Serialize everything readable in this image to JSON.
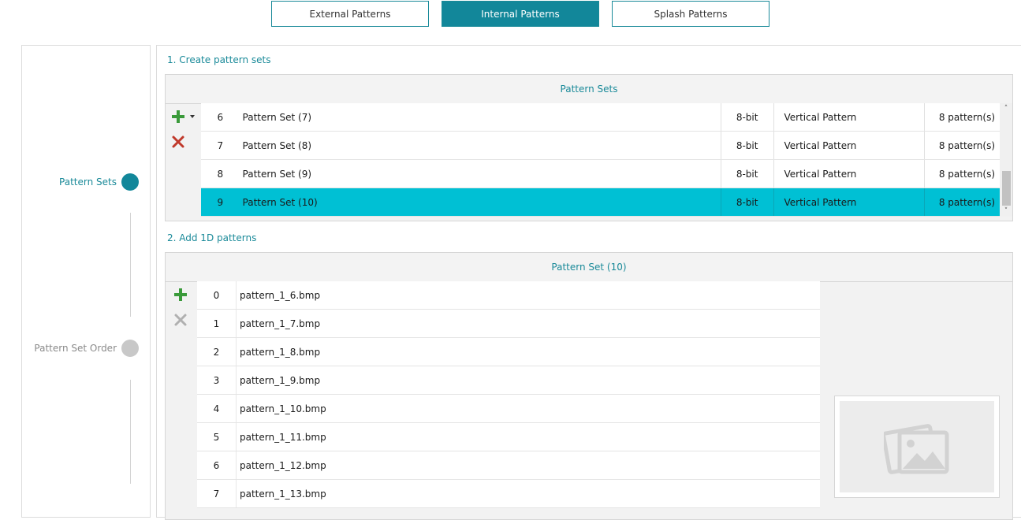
{
  "tabs": [
    {
      "label": "External Patterns",
      "active": false
    },
    {
      "label": "Internal Patterns",
      "active": true
    },
    {
      "label": "Splash Patterns",
      "active": false
    }
  ],
  "steps": [
    {
      "label": "Pattern Sets",
      "state": "active",
      "color": "#12879a"
    },
    {
      "label": "Pattern Set Order",
      "state": "inactive",
      "color": "#c8c8c8"
    }
  ],
  "section1": {
    "title": "1. Create pattern sets",
    "table_header": "Pattern Sets",
    "rows": [
      {
        "index": "6",
        "name": "Pattern Set (7)",
        "bits": "8-bit",
        "type": "Vertical Pattern",
        "count": "8 pattern(s)",
        "selected": false
      },
      {
        "index": "7",
        "name": "Pattern Set (8)",
        "bits": "8-bit",
        "type": "Vertical Pattern",
        "count": "8 pattern(s)",
        "selected": false
      },
      {
        "index": "8",
        "name": "Pattern Set (9)",
        "bits": "8-bit",
        "type": "Vertical Pattern",
        "count": "8 pattern(s)",
        "selected": false
      },
      {
        "index": "9",
        "name": "Pattern Set (10)",
        "bits": "8-bit",
        "type": "Vertical Pattern",
        "count": "8 pattern(s)",
        "selected": true
      }
    ]
  },
  "section2": {
    "title": "2. Add 1D patterns",
    "table_header": "Pattern Set (10)",
    "rows": [
      {
        "index": "0",
        "name": "pattern_1_6.bmp"
      },
      {
        "index": "1",
        "name": "pattern_1_7.bmp"
      },
      {
        "index": "2",
        "name": "pattern_1_8.bmp"
      },
      {
        "index": "3",
        "name": "pattern_1_9.bmp"
      },
      {
        "index": "4",
        "name": "pattern_1_10.bmp"
      },
      {
        "index": "5",
        "name": "pattern_1_11.bmp"
      },
      {
        "index": "6",
        "name": "pattern_1_12.bmp"
      },
      {
        "index": "7",
        "name": "pattern_1_13.bmp"
      }
    ]
  },
  "icons": {
    "add": "plus-icon",
    "add_dropdown": "caret-down-icon",
    "delete": "x-icon",
    "delete_disabled": "x-icon-disabled",
    "image_placeholder": "image-placeholder-icon",
    "scroll_up": "chevron-up-icon",
    "scroll_down": "chevron-down-icon"
  },
  "colors": {
    "accent": "#12879a",
    "selection": "#00c0d4",
    "add_green": "#3a9a3a",
    "delete_red": "#c0392b",
    "disabled_gray": "#b0b0b0"
  }
}
